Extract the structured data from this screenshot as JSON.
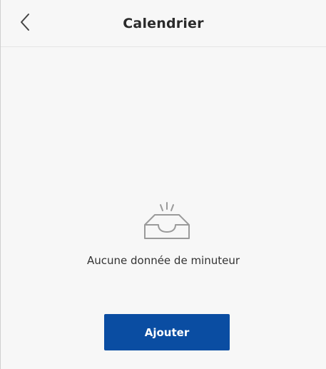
{
  "header": {
    "title": "Calendrier",
    "back_icon": "chevron-left-icon"
  },
  "empty_state": {
    "icon": "empty-inbox-icon",
    "message": "Aucune donnée de minuteur"
  },
  "actions": {
    "add_label": "Ajouter"
  },
  "colors": {
    "primary": "#0a4da2",
    "background": "#f7f7f7",
    "text": "#2b2b2b"
  }
}
